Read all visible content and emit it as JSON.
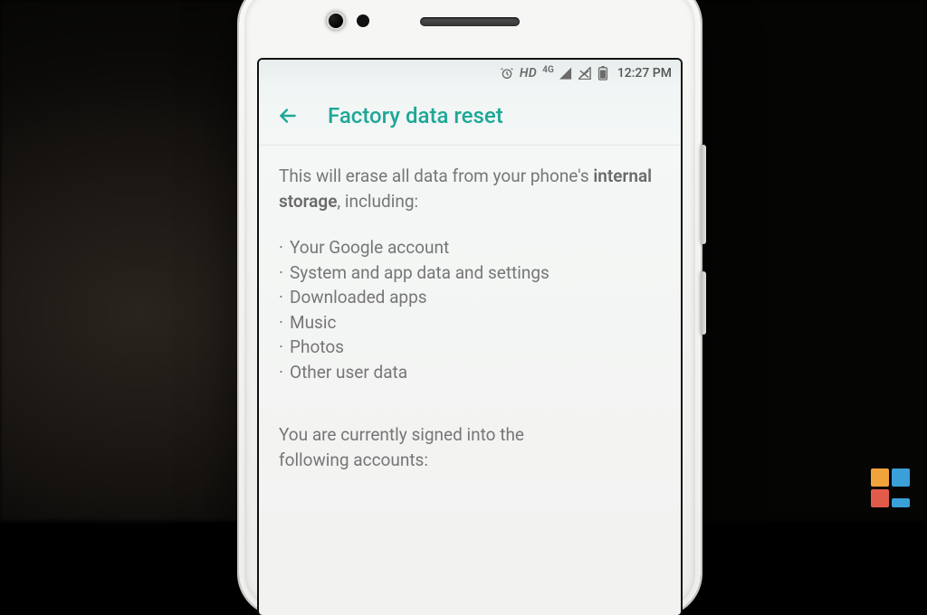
{
  "statusbar": {
    "hd_label": "HD",
    "network_label": "4G",
    "time": "12:27 PM"
  },
  "appbar": {
    "title": "Factory data reset"
  },
  "body": {
    "intro_prefix": "This will erase all data from your phone's ",
    "intro_strong": "internal storage",
    "intro_suffix": ", including:",
    "items": [
      "Your Google account",
      "System and app data and settings",
      "Downloaded apps",
      "Music",
      "Photos",
      "Other user data"
    ],
    "signed_line1": "You are currently signed into the",
    "signed_line2": "following accounts:"
  },
  "colors": {
    "accent": "#1fa796"
  }
}
